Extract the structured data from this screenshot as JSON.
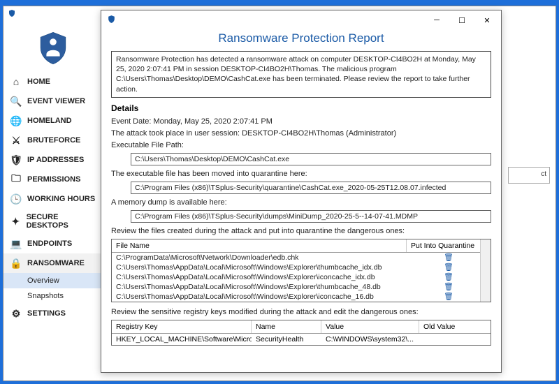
{
  "report": {
    "title": "Ransomware Protection Report",
    "summary": "Ransomware Protection has detected a ransomware attack on computer DESKTOP-CI4BO2H at Monday, May 25, 2020 2:07:41 PM in session DESKTOP-CI4BO2H\\Thomas. The malicious program C:\\Users\\Thomas\\Desktop\\DEMO\\CashCat.exe has been terminated. Please review the report to take further action.",
    "details_heading": "Details",
    "event_date_line": "Event Date: Monday, May 25, 2020 2:07:41 PM",
    "session_line": "The attack took place in user session: DESKTOP-CI4BO2H\\Thomas (Administrator)",
    "exe_path_label": "Executable File Path:",
    "exe_path": "C:\\Users\\Thomas\\Desktop\\DEMO\\CashCat.exe",
    "quarantine_label": "The executable file has been moved into quarantine here:",
    "quarantine_path": "C:\\Program Files (x86)\\TSplus-Security\\quarantine\\CashCat.exe_2020-05-25T12.08.07.infected",
    "dump_label": "A memory dump is available here:",
    "dump_path": "C:\\Program Files (x86)\\TSplus-Security\\dumps\\MiniDump_2020-25-5--14-07-41.MDMP",
    "files_review_label": "Review the files created during the attack and put into quarantine the dangerous ones:",
    "files_header_name": "File Name",
    "files_header_quarantine": "Put Into Quarantine",
    "files": [
      "C:\\ProgramData\\Microsoft\\Network\\Downloader\\edb.chk",
      "C:\\Users\\Thomas\\AppData\\Local\\Microsoft\\Windows\\Explorer\\thumbcache_idx.db",
      "C:\\Users\\Thomas\\AppData\\Local\\Microsoft\\Windows\\Explorer\\iconcache_idx.db",
      "C:\\Users\\Thomas\\AppData\\Local\\Microsoft\\Windows\\Explorer\\thumbcache_48.db",
      "C:\\Users\\Thomas\\AppData\\Local\\Microsoft\\Windows\\Explorer\\iconcache_16.db"
    ],
    "registry_review_label": "Review the sensitive registry keys modified during the attack and edit the dangerous ones:",
    "reg_headers": {
      "key": "Registry Key",
      "name": "Name",
      "value": "Value",
      "old": "Old Value"
    },
    "reg_rows": [
      {
        "key": "HKEY_LOCAL_MACHINE\\Software\\Microsoft\\Windows\\...",
        "name": "SecurityHealth",
        "value": "C:\\WINDOWS\\system32\\...",
        "old": ""
      }
    ]
  },
  "sidebar": {
    "items": [
      {
        "label": "HOME",
        "icon": "home"
      },
      {
        "label": "EVENT VIEWER",
        "icon": "search"
      },
      {
        "label": "HOMELAND",
        "icon": "globe"
      },
      {
        "label": "BRUTEFORCE",
        "icon": "swords"
      },
      {
        "label": "IP ADDRESSES",
        "icon": "shield-check"
      },
      {
        "label": "PERMISSIONS",
        "icon": "folder"
      },
      {
        "label": "WORKING HOURS",
        "icon": "clock"
      },
      {
        "label": "SECURE DESKTOPS",
        "icon": "sparkle"
      },
      {
        "label": "ENDPOINTS",
        "icon": "laptop"
      },
      {
        "label": "RANSOMWARE",
        "icon": "lock"
      },
      {
        "label": "SETTINGS",
        "icon": "gear"
      }
    ],
    "sub": {
      "overview": "Overview",
      "snapshots": "Snapshots"
    }
  },
  "bg_stub": "ct"
}
